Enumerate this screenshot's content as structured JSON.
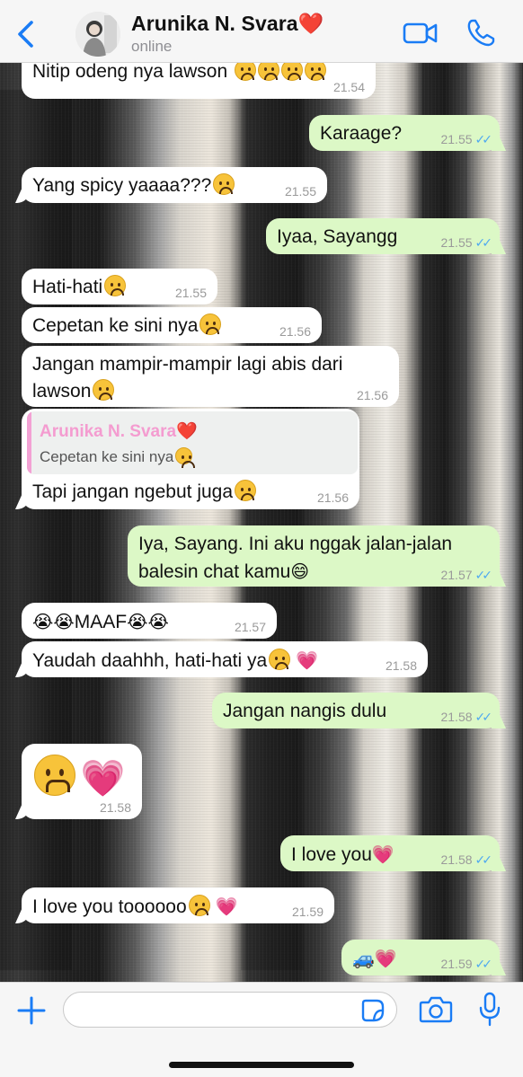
{
  "header": {
    "back_icon": "chevron-left-icon",
    "contact_name": "Arunika N. Svara",
    "contact_heart": "❤️",
    "status": "online",
    "video_icon": "video-camera-icon",
    "call_icon": "phone-icon"
  },
  "colors": {
    "accent": "#1a7cf5",
    "incoming_bubble": "#ffffff",
    "outgoing_bubble": "#dcf8c6",
    "read_ticks": "#4fa9f0",
    "reply_name": "#f49cd0"
  },
  "messages": [
    {
      "dir": "in",
      "text": "Nitip odeng nya lawson",
      "emoji": "☹☹☹☹",
      "time": "21.54"
    },
    {
      "dir": "out",
      "text": "Karaage?",
      "time": "21.55",
      "ticks": "✓✓"
    },
    {
      "dir": "in",
      "text": "Yang spicy yaaaa???",
      "emoji": "☹",
      "time": "21.55"
    },
    {
      "dir": "out",
      "text": "Iyaa, Sayangg",
      "time": "21.55",
      "ticks": "✓✓"
    },
    {
      "dir": "in",
      "text": "Hati-hati",
      "emoji": "☹",
      "time": "21.55"
    },
    {
      "dir": "in",
      "text": "Cepetan ke sini nya",
      "emoji": "☹",
      "time": "21.56"
    },
    {
      "dir": "in",
      "text_line1": "Jangan mampir-mampir lagi abis dari",
      "text_line2": "lawson",
      "emoji": "☹",
      "time": "21.56"
    },
    {
      "dir": "in",
      "reply": {
        "name": "Arunika N. Svara",
        "heart": "❤️",
        "text": "Cepetan ke sini nya",
        "emoji": "☹"
      },
      "text": "Tapi jangan ngebut juga",
      "emoji": "☹",
      "time": "21.56"
    },
    {
      "dir": "out",
      "text_line1": "Iya, Sayang. Ini aku nggak jalan-jalan",
      "text_line2": "balesin chat kamu",
      "emoji": "😄",
      "time": "21.57",
      "ticks": "✓✓"
    },
    {
      "dir": "in",
      "emoji_pre": "😭😭",
      "text": "MAAF",
      "emoji": "😭😭",
      "time": "21.57"
    },
    {
      "dir": "in",
      "text": "Yaudah daahhh, hati-hati ya",
      "emoji": "☹",
      "emoji2": "💗",
      "time": "21.58"
    },
    {
      "dir": "out",
      "text": "Jangan nangis dulu",
      "time": "21.58",
      "ticks": "✓✓"
    },
    {
      "dir": "in",
      "big_emoji": "☹",
      "big_emoji2": "💗",
      "time": "21.58"
    },
    {
      "dir": "out",
      "text": "I love you",
      "emoji": "💗",
      "time": "21.58",
      "ticks": "✓✓"
    },
    {
      "dir": "in",
      "text": "I love you toooooo",
      "emoji": "☹",
      "emoji2": "💗",
      "time": "21.59"
    },
    {
      "dir": "out",
      "emoji_pre": "🚙",
      "emoji": "💗",
      "time": "21.59",
      "ticks": "✓✓"
    }
  ],
  "composer": {
    "plus_icon": "plus-icon",
    "input_value": "",
    "sticker_icon": "sticker-icon",
    "camera_icon": "camera-icon",
    "mic_icon": "microphone-icon"
  }
}
